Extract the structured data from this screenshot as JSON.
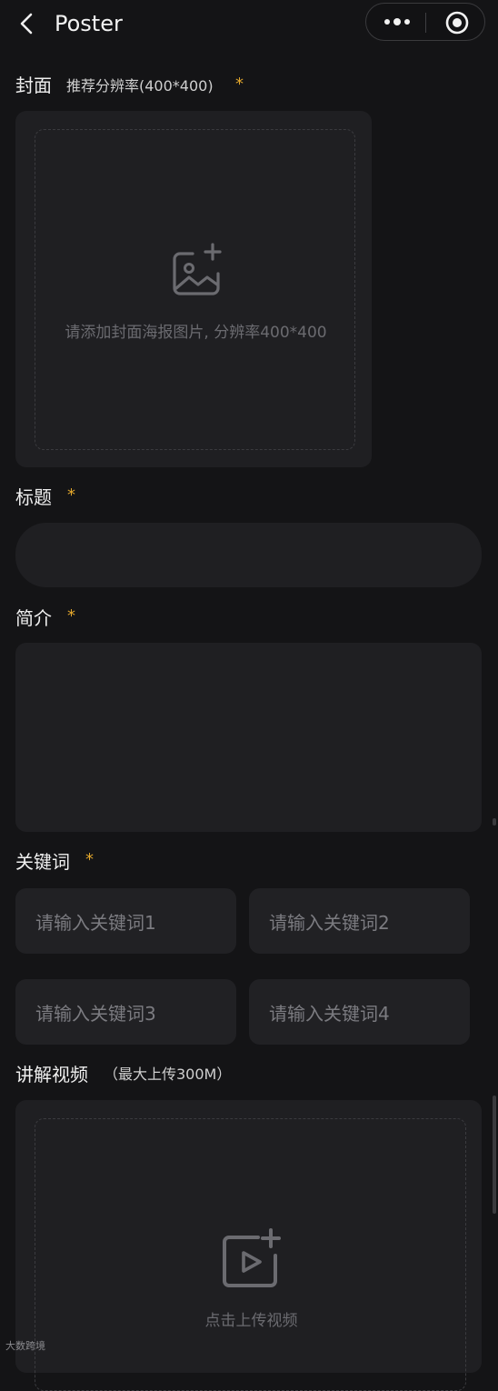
{
  "header": {
    "title": "Poster",
    "back_icon": "chevron-left-icon",
    "more_icon": "more-dots-icon",
    "close_icon": "target-icon"
  },
  "cover": {
    "label": "封面",
    "hint": "推荐分辨率(400*400)",
    "required_mark": "*",
    "upload_icon": "image-add-icon",
    "upload_placeholder": "请添加封面海报图片, 分辨率400*400"
  },
  "title_field": {
    "label": "标题",
    "required_mark": "*",
    "value": ""
  },
  "intro_field": {
    "label": "简介",
    "required_mark": "*",
    "value": ""
  },
  "keywords": {
    "label": "关键词",
    "required_mark": "*",
    "placeholders": [
      "请输入关键词1",
      "请输入关键词2",
      "请输入关键词3",
      "请输入关键词4"
    ]
  },
  "video": {
    "label": "讲解视频",
    "hint": "（最大上传300M）",
    "upload_icon": "video-add-icon",
    "upload_text": "点击上传视频"
  },
  "watermark": "大数跨境",
  "colors": {
    "background": "#141416",
    "card": "#1f1f22",
    "required": "#e3a72c",
    "placeholder": "#6b6b70"
  }
}
